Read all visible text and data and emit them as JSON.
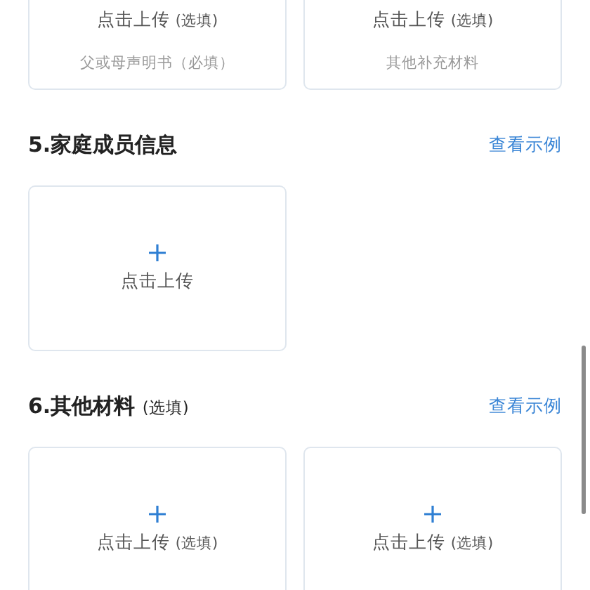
{
  "sections": [
    {
      "cards": [
        {
          "label": "点击上传",
          "note": "(选填)",
          "caption": "父或母声明书（必填）"
        },
        {
          "label": "点击上传",
          "note": "(选填)",
          "caption": "其他补充材料"
        }
      ]
    },
    {
      "title": "5.家庭成员信息",
      "link": "查看示例",
      "cards": [
        {
          "label": "点击上传"
        }
      ]
    },
    {
      "title": "6.其他材料",
      "note": "(选填)",
      "link": "查看示例",
      "cards": [
        {
          "label": "点击上传",
          "note": "(选填)"
        },
        {
          "label": "点击上传",
          "note": "(选填)"
        }
      ]
    }
  ]
}
